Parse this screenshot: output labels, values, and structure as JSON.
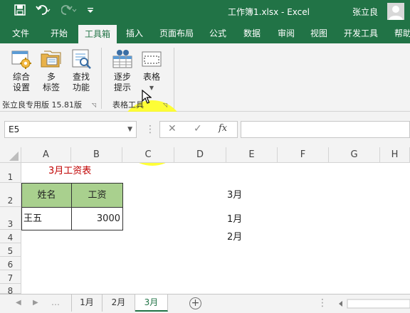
{
  "window": {
    "title": "工作簿1.xlsx  -  Excel",
    "user": "张立良"
  },
  "tabs": [
    {
      "label": "文件"
    },
    {
      "label": "开始"
    },
    {
      "label": "工具箱",
      "active": true
    },
    {
      "label": "插入"
    },
    {
      "label": "页面布局"
    },
    {
      "label": "公式"
    },
    {
      "label": "数据"
    },
    {
      "label": "审阅"
    },
    {
      "label": "视图"
    },
    {
      "label": "开发工具"
    },
    {
      "label": "帮助"
    }
  ],
  "ribbon": {
    "groups": [
      {
        "label": "张立良专用版 15.81版",
        "buttons": [
          {
            "line1": "综合",
            "line2": "设置",
            "icon": "settings-gear-icon"
          },
          {
            "line1": "多",
            "line2": "标签",
            "icon": "multi-tab-folder-icon"
          },
          {
            "line1": "查找",
            "line2": "功能",
            "icon": "find-magnifier-icon"
          }
        ]
      },
      {
        "label": "表格工具",
        "buttons": [
          {
            "line1": "逐步",
            "line2": "提示",
            "icon": "step-hint-icon"
          },
          {
            "line1": "表格",
            "line2": "",
            "icon": "table-icon",
            "dropdown": true
          }
        ]
      }
    ]
  },
  "formula_bar": {
    "name_box": "E5",
    "cancel": "✕",
    "enter": "✓",
    "fx": "fx",
    "value": ""
  },
  "grid": {
    "columns": [
      "A",
      "B",
      "C",
      "D",
      "E",
      "F",
      "G",
      "H"
    ],
    "rows": [
      "1",
      "2",
      "3",
      "4",
      "5",
      "6",
      "7",
      "8"
    ],
    "cells": {
      "A1": "3月工资表",
      "A2": "姓名",
      "B2": "工资",
      "A3": "王五",
      "B3": "3000",
      "E2": "3月",
      "E3": "1月",
      "E4": "2月"
    },
    "title_color": "#c00000",
    "header_fill": "#a9d08e"
  },
  "sheets": [
    {
      "label": "1月"
    },
    {
      "label": "2月"
    },
    {
      "label": "3月",
      "active": true
    }
  ],
  "colors": {
    "accent": "#217346",
    "ribbon_bg": "#f3f3f3",
    "highlight": "#ffff00"
  }
}
